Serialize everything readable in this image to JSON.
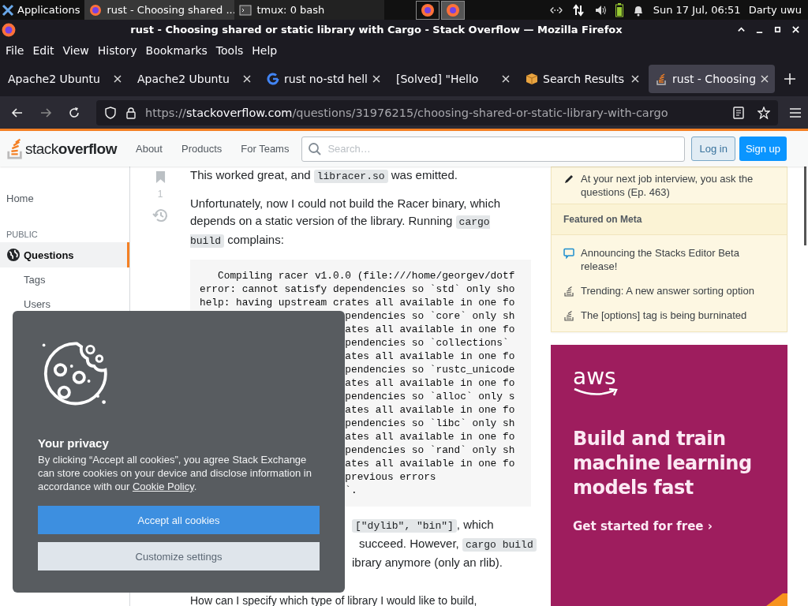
{
  "system_bar": {
    "apps_label": "Applications",
    "windows": [
      {
        "title": "rust - Choosing shared ...",
        "kind": "firefox",
        "selected": true
      },
      {
        "title": "tmux: 0 bash",
        "kind": "terminal",
        "selected": false
      }
    ],
    "clock": "Sun 17 Jul, 06:51",
    "user": "Darty uwu"
  },
  "window": {
    "title": "rust - Choosing shared or static library with Cargo - Stack Overflow — Mozilla Firefox"
  },
  "menu": [
    "File",
    "Edit",
    "View",
    "History",
    "Bookmarks",
    "Tools",
    "Help"
  ],
  "tabs": [
    {
      "label": "Apache2 Ubuntu",
      "kind": "plain",
      "selected": false
    },
    {
      "label": "Apache2 Ubuntu",
      "kind": "plain",
      "selected": false
    },
    {
      "label": "rust no-std hell",
      "kind": "google",
      "selected": false
    },
    {
      "label": "[Solved] \"Hello",
      "kind": "plain",
      "selected": false
    },
    {
      "label": "Search Results",
      "kind": "package",
      "selected": false
    },
    {
      "label": "rust - Choosing",
      "kind": "stack",
      "selected": true
    }
  ],
  "url": {
    "scheme": "https://",
    "host": "stackoverflow.com",
    "path": "/questions/31976215/choosing-shared-or-static-library-with-cargo"
  },
  "site_header": {
    "logo_light": "stack",
    "logo_bold": "overflow",
    "nav": [
      "About",
      "Products",
      "For Teams"
    ],
    "search": {
      "placeholder": "Search…"
    },
    "login": "Log in",
    "signup": "Sign up"
  },
  "left_nav": {
    "home": {
      "label": "Home",
      "selected": false
    },
    "public_heading": "PUBLIC",
    "public_items": [
      {
        "label": "Questions",
        "selected": true
      },
      {
        "label": "Tags",
        "selected": false
      },
      {
        "label": "Users",
        "selected": false
      }
    ]
  },
  "post": {
    "votes": "1",
    "blocks": [
      {
        "kind": "paragraph",
        "segments": [
          {
            "kind": "text",
            "text": "This worked great, and "
          },
          {
            "kind": "code",
            "text": "libracer.so"
          },
          {
            "kind": "text",
            "text": " was emitted."
          }
        ]
      },
      {
        "kind": "paragraph",
        "segments": [
          {
            "kind": "text",
            "text": "Unfortunately, now I could not build the Racer binary, which depends on a static version of the library. Running "
          },
          {
            "kind": "code",
            "text": "cargo build"
          },
          {
            "kind": "text",
            "text": " complains:"
          }
        ]
      },
      {
        "kind": "code",
        "lines": [
          {
            "kind": "full",
            "text": "   Compiling racer v1.0.0 (file:///home/georgev/dotf"
          },
          {
            "kind": "full",
            "text": "error: cannot satisfy dependencies so `std` only sho"
          },
          {
            "kind": "full",
            "text": "help: having upstream crates all available in one fo"
          },
          {
            "kind": "covered",
            "text": "pendencies so `core` only sh"
          },
          {
            "kind": "covered",
            "text": "ates all available in one fo"
          },
          {
            "kind": "covered",
            "text": "pendencies so `collections`"
          },
          {
            "kind": "covered",
            "text": "ates all available in one fo"
          },
          {
            "kind": "covered",
            "text": "pendencies so `rustc_unicode"
          },
          {
            "kind": "covered",
            "text": "ates all available in one fo"
          },
          {
            "kind": "covered",
            "text": "pendencies so `alloc` only s"
          },
          {
            "kind": "covered",
            "text": "ates all available in one fo"
          },
          {
            "kind": "covered",
            "text": "pendencies so `libc` only sh"
          },
          {
            "kind": "covered",
            "text": "ates all available in one fo"
          },
          {
            "kind": "covered",
            "text": "pendencies so `rand` only sh"
          },
          {
            "kind": "covered",
            "text": "ates all available in one fo"
          },
          {
            "kind": "covered",
            "text": "previous errors"
          },
          {
            "kind": "covered",
            "text": "`."
          }
        ]
      },
      {
        "kind": "covered_paragraph",
        "lines": [
          [
            {
              "kind": "code",
              "text": "[\"dylib\", \"bin\"]"
            },
            {
              "kind": "text",
              "text": ", which"
            }
          ],
          [
            {
              "kind": "text",
              "text": "succeed. However, "
            },
            {
              "kind": "code",
              "text": "cargo build"
            }
          ],
          [
            {
              "kind": "text",
              "text": "ibrary anymore (only an rlib)."
            }
          ]
        ]
      },
      {
        "kind": "paragraph",
        "segments": [
          {
            "kind": "text",
            "text": "How can I specify which type of library I would like to build,"
          }
        ]
      }
    ]
  },
  "right_sidebar": {
    "blog_items": [
      {
        "text": "At your next job interview, you ask the questions (Ep. 463)"
      }
    ],
    "meta_heading": "Featured on Meta",
    "meta_items": [
      {
        "text": "Announcing the Stacks Editor Beta release!",
        "kind": "chat"
      },
      {
        "text": "Trending: A new answer sorting option",
        "kind": "stack"
      },
      {
        "text": "The [options] tag is being burninated",
        "kind": "stack"
      }
    ],
    "ad": {
      "logo": "aws",
      "headline": "Build and train machine learning models fast",
      "cta": "Get started for free ›"
    }
  },
  "cookie": {
    "title": "Your privacy",
    "text_before": "By clicking “Accept all cookies”, you agree Stack Exchange can store cookies on your device and disclose information in accordance with our ",
    "link": "Cookie Policy",
    "text_after": ".",
    "accept": "Accept all cookies",
    "customize": "Customize settings"
  }
}
